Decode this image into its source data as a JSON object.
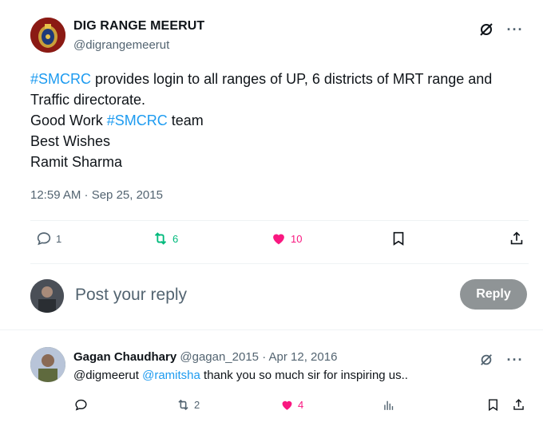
{
  "tweet": {
    "author_name": "DIG RANGE MEERUT",
    "author_handle": "@digrangemeerut",
    "body": {
      "line1_hashtag": "#SMCRC",
      "line1_text": " provides login to all ranges of UP, 6 districts of MRT range and",
      "line2": "Traffic directorate.",
      "line3_prefix": "Good Work ",
      "line3_hashtag": "#SMCRC",
      "line3_suffix": " team",
      "line4": "Best Wishes",
      "line5": "Ramit Sharma"
    },
    "timestamp": "12:59 AM · Sep 25, 2015",
    "stats": {
      "replies": "1",
      "retweets": "6",
      "likes": "10"
    }
  },
  "reply_composer": {
    "placeholder": "Post your reply",
    "button_label": "Reply"
  },
  "reply": {
    "author_name": "Gagan Chaudhary",
    "meta": " @gagan_2015 · Apr 12, 2016",
    "mention1": "@digmeerut",
    "mention2": "@ramitsha",
    "text": " thank you so much sir for inspiring us..",
    "stats": {
      "retweets": "2",
      "likes": "4"
    }
  },
  "colors": {
    "link": "#1d9bf0",
    "retweet": "#00ba7c",
    "like": "#f91880",
    "muted": "#536471"
  },
  "icons": [
    "grok-icon",
    "more-icon",
    "reply-icon",
    "retweet-icon",
    "heart-icon",
    "bookmark-icon",
    "share-icon",
    "views-icon"
  ]
}
